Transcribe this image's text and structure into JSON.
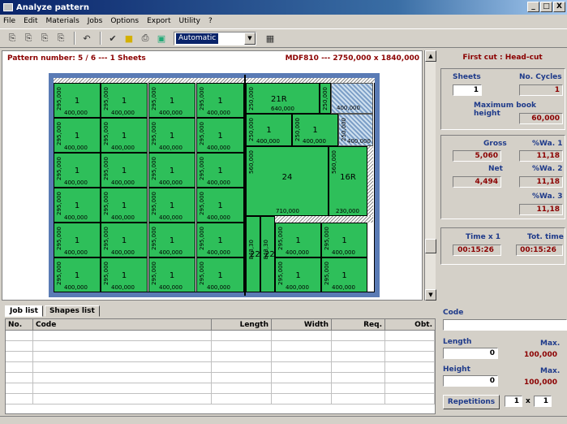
{
  "window": {
    "title": "Analyze pattern",
    "min": "_",
    "max": "□",
    "close": "X"
  },
  "menu": [
    "File",
    "Edit",
    "Materials",
    "Jobs",
    "Options",
    "Export",
    "Utility",
    "?"
  ],
  "toolbar": {
    "mode": "Automatic"
  },
  "pattern": {
    "number_label": "Pattern number: 5 / 6 --- 1 Sheets",
    "material": "MDF810 --- 2750,000 x 1840,000"
  },
  "side": {
    "first_cut": "First cut : Head-cut",
    "sheets_label": "Sheets",
    "sheets_value": "1",
    "cycles_label": "No. Cycles",
    "cycles_value": "1",
    "book_label": "Maximum book height",
    "book_value": "60,000",
    "gross_label": "Gross",
    "gross_value": "5,060",
    "wa1_label": "%Wa. 1",
    "wa1_value": "11,18",
    "net_label": "Net",
    "net_value": "4,494",
    "wa2_label": "%Wa. 2",
    "wa2_value": "11,18",
    "wa3_label": "%Wa. 3",
    "wa3_value": "11,18",
    "time_label": "Time x 1",
    "time_value": "00:15:26",
    "tot_label": "Tot. time",
    "tot_value": "00:15:26"
  },
  "tabs": [
    "Job list",
    "Shapes list"
  ],
  "table": {
    "headers": [
      "No.",
      "Code",
      "Length",
      "Width",
      "Req.",
      "Obt."
    ]
  },
  "bottom": {
    "code_label": "Code",
    "length_label": "Length",
    "length_value": "0",
    "max_label1": "Max.",
    "max_value1": "100,000",
    "height_label": "Height",
    "height_value": "0",
    "max_label2": "Max.",
    "max_value2": "100,000",
    "rep_label": "Repetitions",
    "rep_a": "1",
    "rep_x": "x",
    "rep_b": "1"
  },
  "pieces": {
    "p1": {
      "label": "1",
      "w": "400,000",
      "h": "295,000"
    },
    "p21": {
      "label": "21R",
      "w": "640,000",
      "h": "250,000"
    },
    "p24": {
      "label": "24",
      "w": "710,000",
      "h": "560,000"
    },
    "p16": {
      "label": "16R",
      "w": "230,000",
      "h": "560,000"
    },
    "p22": {
      "label": "22",
      "h": "843,30"
    },
    "sm": {
      "w": "400,000",
      "h": "250,000"
    },
    "top400": "400,000"
  }
}
